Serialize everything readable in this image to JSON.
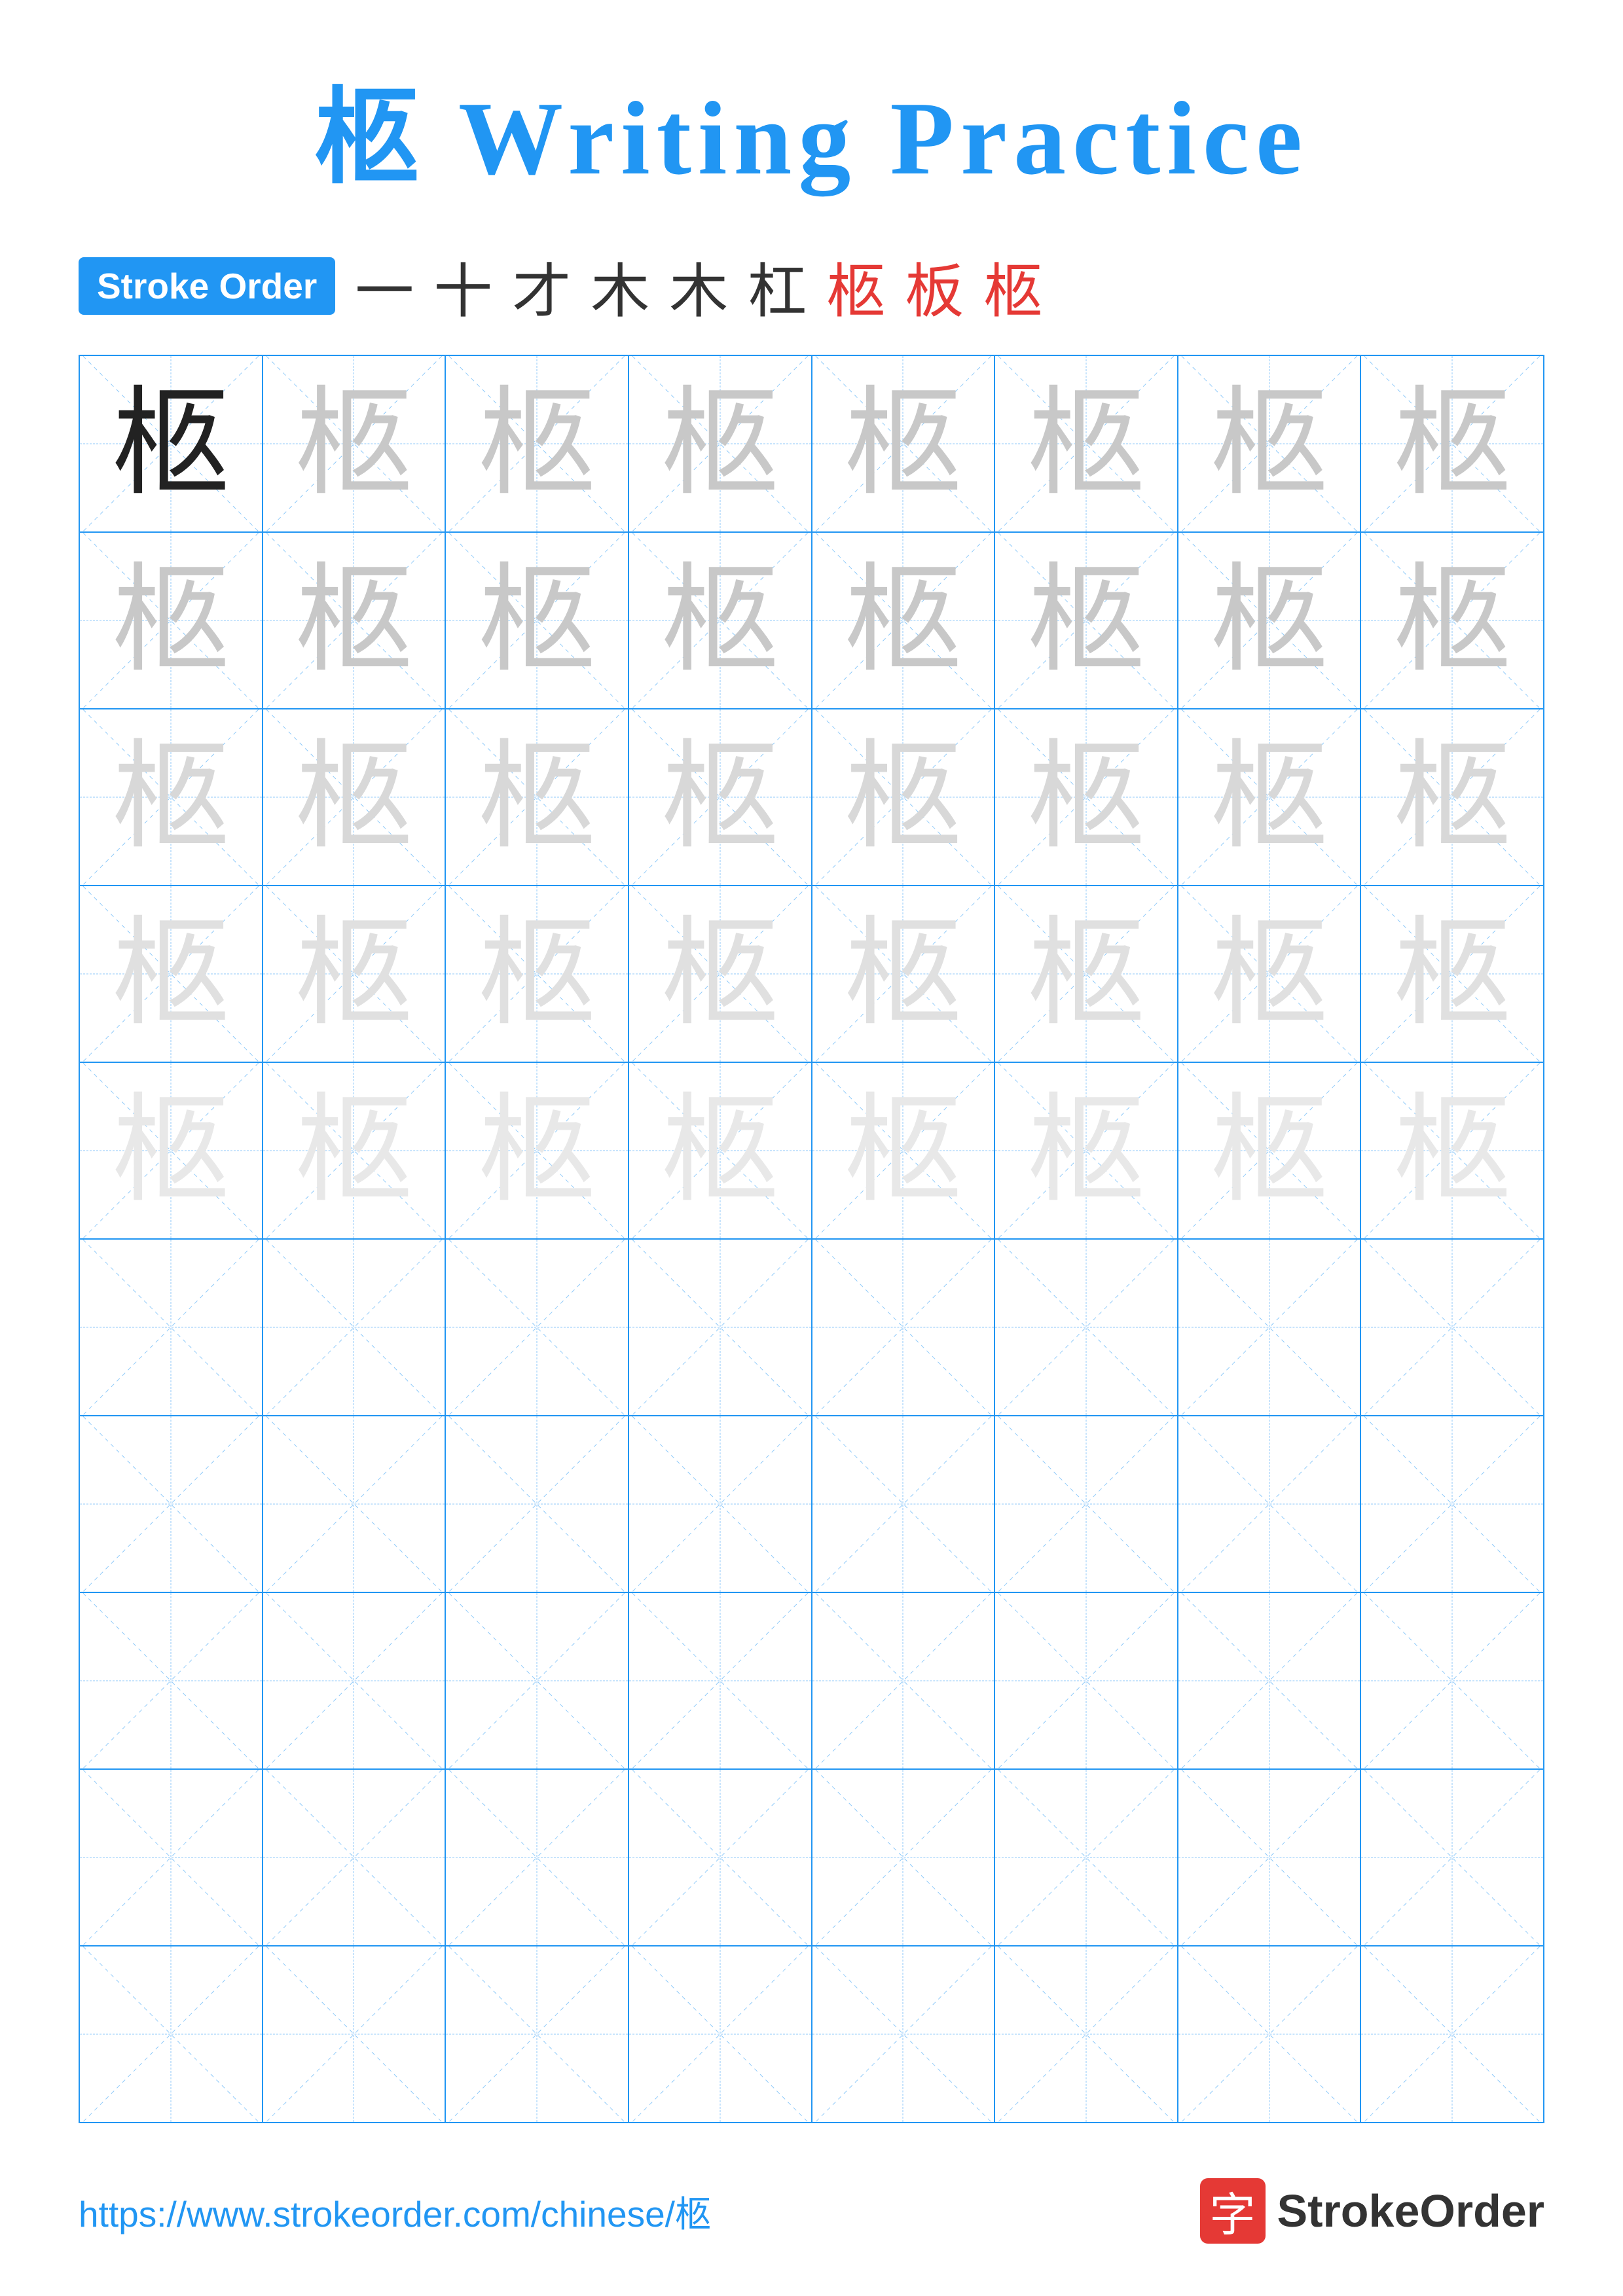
{
  "title": {
    "character": "柩",
    "text": "Writing Practice",
    "full": "柩 Writing Practice"
  },
  "stroke_order": {
    "badge_label": "Stroke Order",
    "strokes": [
      "一",
      "十",
      "才",
      "木",
      "木",
      "杠",
      "柩",
      "板",
      "柩"
    ]
  },
  "grid": {
    "rows": 10,
    "cols": 8,
    "character": "柩",
    "practice_rows": 5,
    "empty_rows": 5
  },
  "footer": {
    "url": "https://www.strokeorder.com/chinese/柩",
    "logo_char": "字",
    "logo_name": "StrokeOrder"
  },
  "colors": {
    "blue": "#2196F3",
    "red": "#e53935",
    "dark": "#222222",
    "light1": "#c8c8c8",
    "light2": "#d4d4d4",
    "light3": "#dddddd",
    "light4": "#e6e6e6"
  }
}
